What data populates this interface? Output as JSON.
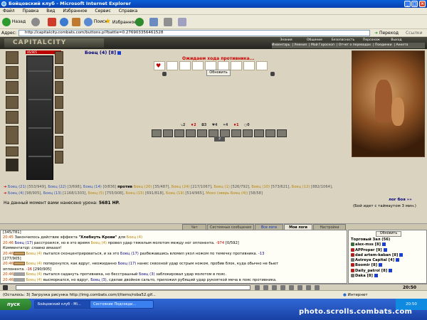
{
  "window": {
    "title": "Бойцовский клуб - Microsoft Internet Explorer"
  },
  "menu": [
    "Файл",
    "Правка",
    "Вид",
    "Избранное",
    "Сервис",
    "Справка"
  ],
  "toolbar": {
    "back": "Назад",
    "search": "Поиск",
    "favorites": "Избранное"
  },
  "address": {
    "label": "Адрес:",
    "url": "http://capitalcity.combats.com/buttons.pl?battle=0.276903356461528",
    "go": "Переход",
    "links": "Ссылки"
  },
  "site": {
    "logo": "CAPITALCITY",
    "nav_top": [
      "Знания",
      "Общение",
      "Безопасность",
      "Персонаж",
      "Выход"
    ],
    "nav_bottom": [
      "Инвентарь",
      "Умения",
      "Мой Гороскоп",
      "Отчет о переводах",
      "Поединки",
      "Анкета"
    ]
  },
  "player": {
    "name": "Боец (4) [8]",
    "hp": "46/905"
  },
  "battle": {
    "waiting": "Ожидаем хода противника...",
    "refresh": "Обновить",
    "stats": [
      "2",
      "2",
      "3",
      "4",
      "4",
      "1",
      "0"
    ],
    "marker": "2",
    "line1": [
      {
        "t": "Боец (21)",
        "c": "blue"
      },
      {
        "t": "[553/949],",
        "c": "gray"
      },
      {
        "t": "Боец (22)",
        "c": "blue"
      },
      {
        "t": "[3/698],",
        "c": "gray"
      },
      {
        "t": "Боец (14)",
        "c": "blue"
      },
      {
        "t": "[0/836]",
        "c": "gray"
      },
      {
        "t": "против",
        "c": "bold"
      },
      {
        "t": "Боец (20)",
        "c": "orange"
      },
      {
        "t": "[35/487],",
        "c": "gray"
      },
      {
        "t": "Боец (24)",
        "c": "orange"
      },
      {
        "t": "[217/1067],",
        "c": "gray"
      },
      {
        "t": "Боец (1)",
        "c": "orange"
      },
      {
        "t": "[526/792],",
        "c": "gray"
      },
      {
        "t": "Боец (10)",
        "c": "orange"
      },
      {
        "t": "[573/621],",
        "c": "gray"
      },
      {
        "t": "Боец (12)",
        "c": "orange"
      },
      {
        "t": "[882/1064],",
        "c": "gray"
      }
    ],
    "line2": [
      {
        "t": "Боец (4)",
        "c": "blue"
      },
      {
        "t": "[98/905],",
        "c": "gray"
      },
      {
        "t": "Боец (13)",
        "c": "blue"
      },
      {
        "t": "[1168/1303],",
        "c": "gray"
      },
      {
        "t": "Боец (5)",
        "c": "orange"
      },
      {
        "t": "[755/908],",
        "c": "gray"
      },
      {
        "t": "Боец (15)",
        "c": "orange"
      },
      {
        "t": "[691/818],",
        "c": "gray"
      },
      {
        "t": "Боец (19)",
        "c": "orange"
      },
      {
        "t": "[514/965],",
        "c": "gray"
      },
      {
        "t": "Мохо (зверь Боец (4))",
        "c": "orange"
      },
      {
        "t": "[58/58]",
        "c": "gray"
      }
    ],
    "damage_label": "На данный момент вами нанесено урона:",
    "damage_value": "5681 HP.",
    "fight_log": "лог боя »»",
    "timeout": "(Бой идет с таймаутом 3 мин.)"
  },
  "chat": {
    "tabs": [
      "Чат",
      "Системные сообщения",
      "Все логи",
      "Мои логи",
      "Настройки"
    ],
    "lines": [
      {
        "parts": [
          {
            "t": "[345/781]",
            "c": ""
          }
        ]
      },
      {
        "parts": [
          {
            "t": "20:45",
            "c": "t"
          },
          {
            "t": " Закончилось действие эффекта ",
            "c": ""
          },
          {
            "t": "\"Хлебнуть Крови\"",
            "c": "bold"
          },
          {
            "t": " для ",
            "c": ""
          },
          {
            "t": "Боец (4)",
            "c": "orange"
          }
        ]
      },
      {
        "parts": [
          {
            "t": "20:46",
            "c": "t"
          },
          {
            "t": " Боец (17)",
            "c": "navy"
          },
          {
            "t": " расстроился, но в это время ",
            "c": ""
          },
          {
            "t": "Боец (4)",
            "c": "orange"
          },
          {
            "t": " провел удар тяжелым молотом между ног оппонента. ",
            "c": ""
          },
          {
            "t": "-974",
            "c": "red"
          },
          {
            "t": " [0/592]",
            "c": ""
          }
        ]
      },
      {
        "parts": [
          {
            "t": "Комментатор: славно вмазал!",
            "c": "i"
          }
        ]
      },
      {
        "parts": [
          {
            "t": "20:46",
            "c": "t"
          },
          {
            "t": "",
            "c": "tag"
          },
          {
            "t": " Боец (4)",
            "c": "orange"
          },
          {
            "t": " пытался сконцентрироваться, и за это ",
            "c": ""
          },
          {
            "t": "Боец (17)",
            "c": "navy"
          },
          {
            "t": " разбежавшись вломил укол ножом по темечку противника. ",
            "c": ""
          },
          {
            "t": "-13",
            "c": "navy"
          }
        ]
      },
      {
        "parts": [
          {
            "t": "[277/905]",
            "c": ""
          }
        ]
      },
      {
        "parts": [
          {
            "t": "20:46",
            "c": "t"
          },
          {
            "t": "",
            "c": "tag"
          },
          {
            "t": " Боец (4)",
            "c": "orange"
          },
          {
            "t": " поперхнулся, как вдруг, неожиданно ",
            "c": ""
          },
          {
            "t": "Боец (17)",
            "c": "navy"
          },
          {
            "t": " нанес сквозной удар острым ножом, пробив блок, куда обычно не бьют",
            "c": ""
          }
        ]
      },
      {
        "parts": [
          {
            "t": "оппонента. ",
            "c": ""
          },
          {
            "t": "-16",
            "c": "red"
          },
          {
            "t": " [290/905]",
            "c": ""
          }
        ]
      },
      {
        "parts": [
          {
            "t": "20:46",
            "c": "t"
          },
          {
            "t": "",
            "c": "tag2"
          },
          {
            "t": " Боец (4)",
            "c": "orange"
          },
          {
            "t": " пытался садануть противника, но бесстрашный ",
            "c": ""
          },
          {
            "t": "Боец (3)",
            "c": "navy"
          },
          {
            "t": " заблокировал удар молотом в пояс.",
            "c": ""
          }
        ]
      },
      {
        "parts": [
          {
            "t": "20:46",
            "c": "t"
          },
          {
            "t": "",
            "c": "tag2"
          },
          {
            "t": " Боец (4)",
            "c": "orange"
          },
          {
            "t": " высморкался, но вдруг, ",
            "c": ""
          },
          {
            "t": "Боец (3)",
            "c": "navy"
          },
          {
            "t": ", сделав двойное сальто, приложил рубящий удар рукояткой меча в пояс противника.",
            "c": ""
          }
        ]
      },
      {
        "parts": [
          {
            "t": "-25 T306/905]",
            "c": ""
          }
        ]
      }
    ],
    "clock": "20:50"
  },
  "users": {
    "update": "Обновить",
    "header": "Торговый Зал (56)",
    "list": [
      {
        "name": "alex-mss [8]",
        "icon": "#3a6a3a"
      },
      {
        "name": "APProper [9]",
        "icon": "#b02020"
      },
      {
        "name": "dad artem-kaban [8]",
        "icon": "#b02020"
      },
      {
        "name": "Astreya Capital [4]",
        "icon": "#707070"
      },
      {
        "name": "Boomir [8]",
        "icon": "#b02020"
      },
      {
        "name": "Daily_patrol [8]",
        "icon": "#b02020"
      },
      {
        "name": "Daka [8]",
        "icon": "#707070"
      }
    ]
  },
  "status": {
    "text": "(Осталось: 3) Загрузка рисунка http://img.combats.com/i/items/roba52.gif...",
    "zone": "Интернет"
  },
  "taskbar": {
    "start": "пуск",
    "tasks": [
      "Бойцовский клуб - Mi...",
      "Состояние Подсоеди..."
    ],
    "time": "20:50"
  },
  "watermark": "photo.scrolls.combats.com"
}
